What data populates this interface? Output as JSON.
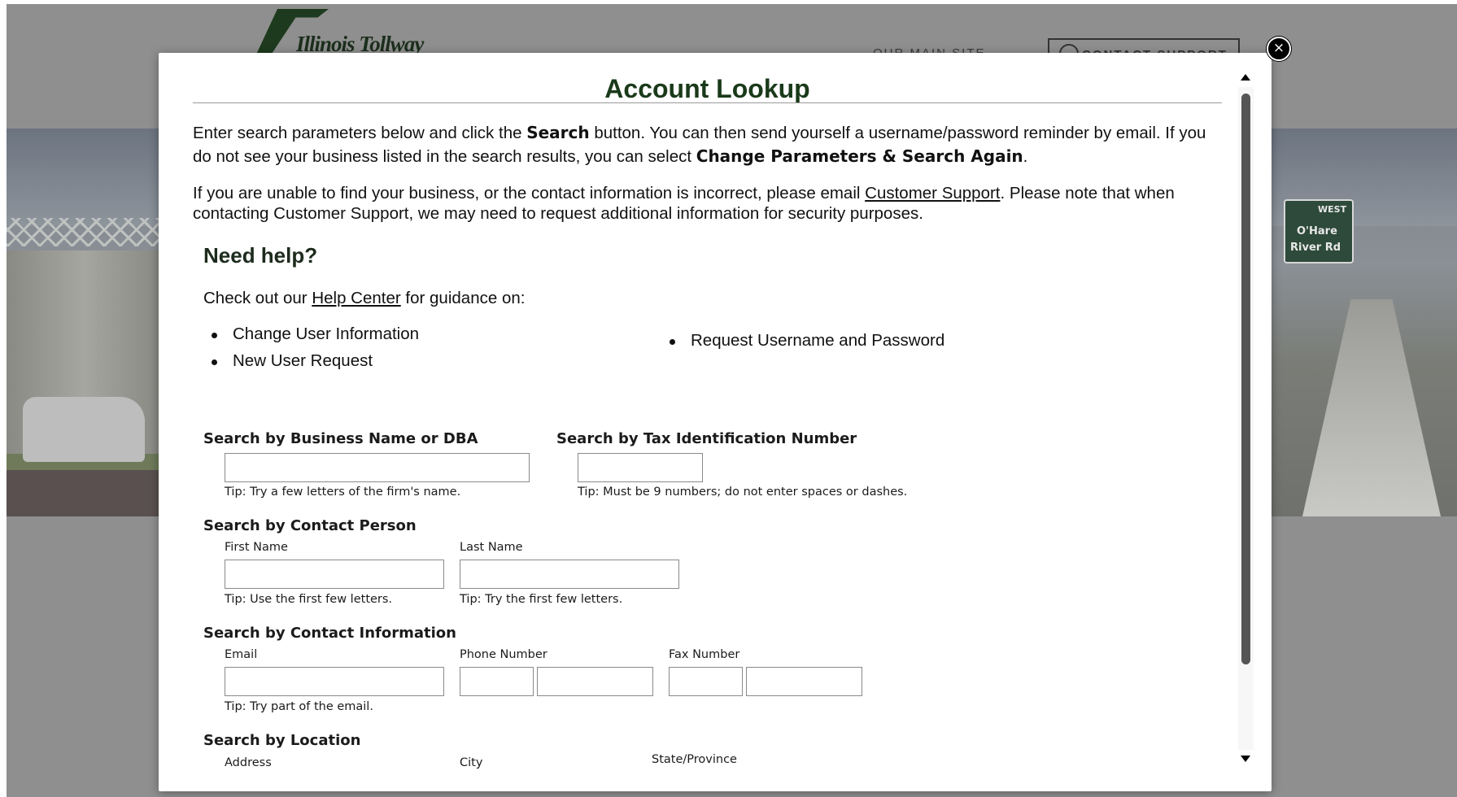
{
  "background": {
    "logo_text": "Illinois Tollway",
    "nav_link": "OUR MAIN SITE",
    "support_button": "CONTACT SUPPORT",
    "sign_line1": "WEST",
    "sign_line2": "O'Hare",
    "sign_line3": "River Rd"
  },
  "modal": {
    "close_label": "×",
    "title": "Account Lookup",
    "intro": {
      "p1_a": "Enter search parameters below and click the ",
      "p1_b": "Search",
      "p1_c": " button. You can then send yourself a username/password reminder by email. If you do not see your business listed in the search results, you can select ",
      "p1_d": "Change Parameters & Search Again",
      "p1_e": ".",
      "p2_a": "If you are unable to find your business, or the contact information is incorrect, please email ",
      "p2_link": "Customer Support",
      "p2_b": ". Please note that when contacting Customer Support, we may need to request additional information for security purposes."
    },
    "help": {
      "title": "Need help?",
      "intro_a": "Check out our ",
      "intro_link": "Help Center",
      "intro_b": " for guidance on:",
      "links_left": [
        "Change User Information",
        "New User Request"
      ],
      "links_right": [
        "Request Username and Password"
      ]
    },
    "search_business": {
      "heading": "Search by Business Name or DBA",
      "value": "",
      "tip": "Tip: Try a few letters of the firm's name."
    },
    "search_tax": {
      "heading": "Search by Tax Identification Number",
      "value": "",
      "tip": "Tip: Must be 9 numbers; do not enter spaces or dashes."
    },
    "search_person": {
      "heading": "Search by Contact Person",
      "first_label": "First Name",
      "first_tip": "Tip: Use the first few letters.",
      "last_label": "Last Name",
      "last_tip": "Tip: Try the first few letters."
    },
    "search_contact": {
      "heading": "Search by Contact Information",
      "email_label": "Email",
      "email_tip": "Tip: Try part of the email.",
      "phone_label": "Phone Number",
      "fax_label": "Fax Number"
    },
    "search_location": {
      "heading": "Search by Location",
      "address_label": "Address",
      "city_label": "City",
      "state_label": "State/Province"
    }
  }
}
